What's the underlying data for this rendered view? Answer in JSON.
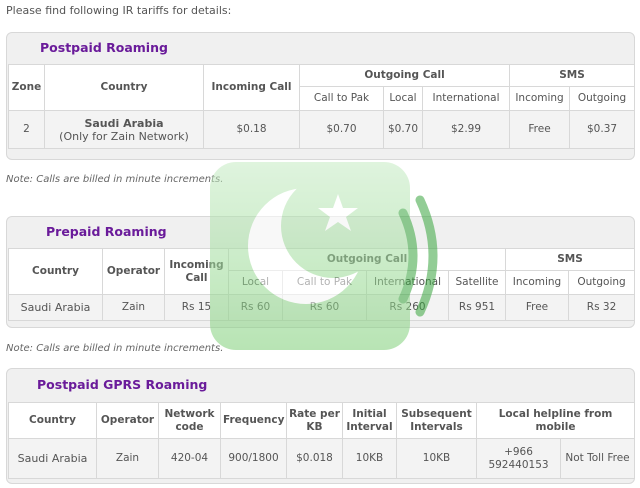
{
  "intro": "Please find following IR tariffs for details:",
  "note_text": "Note: Calls are billed in minute increments.",
  "postpaid": {
    "title": "Postpaid Roaming",
    "headers": {
      "zone": "Zone",
      "country": "Country",
      "incoming_call": "Incoming Call",
      "outgoing_call": "Outgoing Call",
      "sms": "SMS",
      "call_to_pak": "Call to Pak",
      "local": "Local",
      "international": "International",
      "incoming": "Incoming",
      "outgoing": "Outgoing"
    },
    "row": {
      "zone": "2",
      "country": "Saudi Arabia",
      "country_note": "(Only for Zain Network)",
      "incoming_call": "$0.18",
      "call_to_pak": "$0.70",
      "local": "$0.70",
      "international": "$2.99",
      "sms_incoming": "Free",
      "sms_outgoing": "$0.37"
    }
  },
  "prepaid": {
    "title": "Prepaid Roaming",
    "headers": {
      "country": "Country",
      "operator": "Operator",
      "incoming_call": "Incoming Call",
      "outgoing_call": "Outgoing Call",
      "sms": "SMS",
      "local": "Local",
      "call_to_pak": "Call to Pak",
      "international": "International",
      "satellite": "Satellite",
      "incoming": "Incoming",
      "outgoing": "Outgoing"
    },
    "row": {
      "country": "Saudi Arabia",
      "operator": "Zain",
      "incoming_call": "Rs 15",
      "local": "Rs 60",
      "call_to_pak": "Rs 60",
      "international": "Rs 260",
      "satellite": "Rs 951",
      "sms_incoming": "Free",
      "sms_outgoing": "Rs 32"
    }
  },
  "gprs": {
    "title": "Postpaid GPRS Roaming",
    "headers": {
      "country": "Country",
      "operator": "Operator",
      "network_code": "Network code",
      "frequency": "Frequency",
      "rate_per_kb": "Rate per KB",
      "initial_interval": "Initial Interval",
      "subsequent_intervals": "Subsequent Intervals",
      "local_helpline": "Local helpline from mobile"
    },
    "row": {
      "country": "Saudi Arabia",
      "operator": "Zain",
      "network_code": "420-04",
      "frequency": "900/1800",
      "rate_per_kb": "$0.018",
      "initial_interval": "10KB",
      "subsequent_intervals": "10KB",
      "helpline_number": "+966 592440153",
      "helpline_type": "Not Toll Free"
    }
  },
  "colors": {
    "title_purple": "#6a1b9a",
    "logo_green": "#2e9e3a"
  },
  "icons": {
    "logo": "pakistan-flag-signal-logo"
  }
}
